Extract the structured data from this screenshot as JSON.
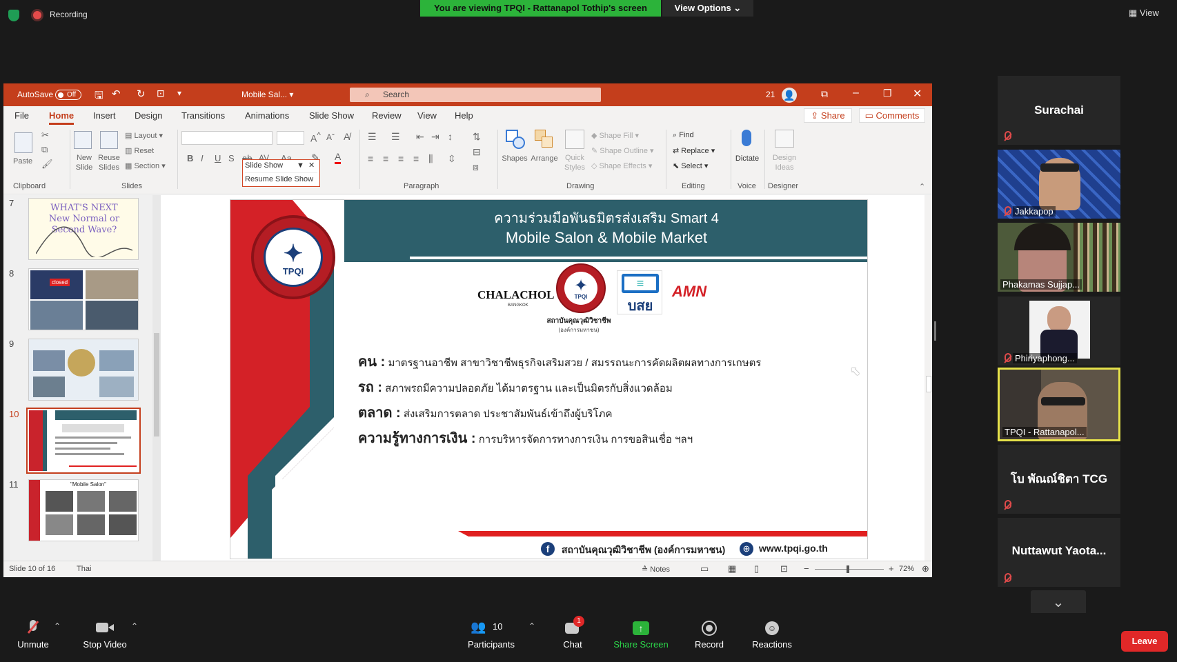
{
  "topbar": {
    "recording_label": "Recording",
    "viewing_banner": "You are viewing TPQI - Rattanapol Tothip's screen",
    "view_options": "View Options",
    "view_label": "View"
  },
  "ppt": {
    "autosave_label": "AutoSave",
    "autosave_state": "Off",
    "doc_title": "Mobile Sal...",
    "search_placeholder": "Search",
    "notif_count": "21",
    "menu": [
      "File",
      "Home",
      "Insert",
      "Design",
      "Transitions",
      "Animations",
      "Slide Show",
      "Review",
      "View",
      "Help"
    ],
    "share_label": "Share",
    "comments_label": "Comments",
    "ribbon": {
      "paste": "Paste",
      "new_slide": "New Slide",
      "reuse_slides": "Reuse Slides",
      "layout": "Layout",
      "reset": "Reset",
      "section": "Section",
      "shapes": "Shapes",
      "arrange": "Arrange",
      "quick_styles": "Quick Styles",
      "shape_fill": "Shape Fill",
      "shape_outline": "Shape Outline",
      "shape_effects": "Shape Effects",
      "find": "Find",
      "replace": "Replace",
      "select": "Select",
      "dictate": "Dictate",
      "design_ideas": "Design Ideas",
      "groups": {
        "clipboard": "Clipboard",
        "slides": "Slides",
        "paragraph": "Paragraph",
        "drawing": "Drawing",
        "editing": "Editing",
        "voice": "Voice",
        "designer": "Designer"
      }
    },
    "slideshow_popup": {
      "title": "Slide Show",
      "resume": "Resume Slide Show"
    },
    "thumbnails": [
      {
        "num": "7",
        "text": "WHAT'S NEXT New Normal or Second Wave?"
      },
      {
        "num": "8",
        "text": "closed"
      },
      {
        "num": "9",
        "text": ""
      },
      {
        "num": "10",
        "text": ""
      },
      {
        "num": "11",
        "text": "\"Mobile Salon\""
      }
    ],
    "slide": {
      "header_line1": "ความร่วมมือพันธมิตรส่งเสริม Smart 4",
      "header_line2": "Mobile Salon & Mobile Market",
      "logo_chalachol": "CHALACHOL",
      "logo_chalachol_sub": "BANGKOK",
      "logo_tpqi": "TPQI",
      "logo_tpqi_caption1": "สถาบันคุณวุฒิวิชาชีพ",
      "logo_tpqi_caption2": "(องค์การมหาชน)",
      "logo_bsy": "บสย",
      "logo_amn": "AMN",
      "bullets": [
        {
          "label": "คน :",
          "text": "มาตรฐานอาชีพ สาขาวิชาชีพธุรกิจเสริมสวย / สมรรถนะการคัดผลิตผลทางการเกษตร"
        },
        {
          "label": "รถ :",
          "text": "สภาพรถมีความปลอดภัย ได้มาตรฐาน และเป็นมิตรกับสิ่งแวดล้อม"
        },
        {
          "label": "ตลาด :",
          "text": "ส่งเสริมการตลาด ประชาสัมพันธ์เข้าถึงผู้บริโภค"
        },
        {
          "label": "ความรู้ทางการเงิน :",
          "text": "การบริหารจัดการทางการเงิน การขอสินเชื่อ ฯลฯ"
        }
      ],
      "footer_fb": "สถาบันคุณวุฒิวิชาชีพ (องค์การมหาชน)",
      "footer_web": "www.tpqi.go.th"
    },
    "status": {
      "slide_info": "Slide 10 of 16",
      "language": "Thai",
      "notes": "Notes",
      "zoom": "72%"
    }
  },
  "participants": [
    {
      "name": "Surachai",
      "video": false
    },
    {
      "name": "Jakkapop",
      "video": true
    },
    {
      "name": "Phakamas Sujjap...",
      "video": true
    },
    {
      "name": "Phiriyaphong...",
      "video": true
    },
    {
      "name": "TPQI - Rattanapol...",
      "video": true
    },
    {
      "name": "โบ พัณณ์ชิตา TCG",
      "video": false
    },
    {
      "name": "Nuttawut Yaota...",
      "video": false
    }
  ],
  "bottombar": {
    "unmute": "Unmute",
    "stop_video": "Stop Video",
    "participants": "Participants",
    "participants_count": "10",
    "chat": "Chat",
    "chat_badge": "1",
    "share_screen": "Share Screen",
    "record": "Record",
    "reactions": "Reactions",
    "leave": "Leave"
  },
  "colors": {
    "ppt_red": "#c43e1c",
    "zoom_green": "#2cb33a",
    "slide_teal": "#2d5f6b",
    "slide_red": "#e02020",
    "leave_red": "#e02828"
  }
}
